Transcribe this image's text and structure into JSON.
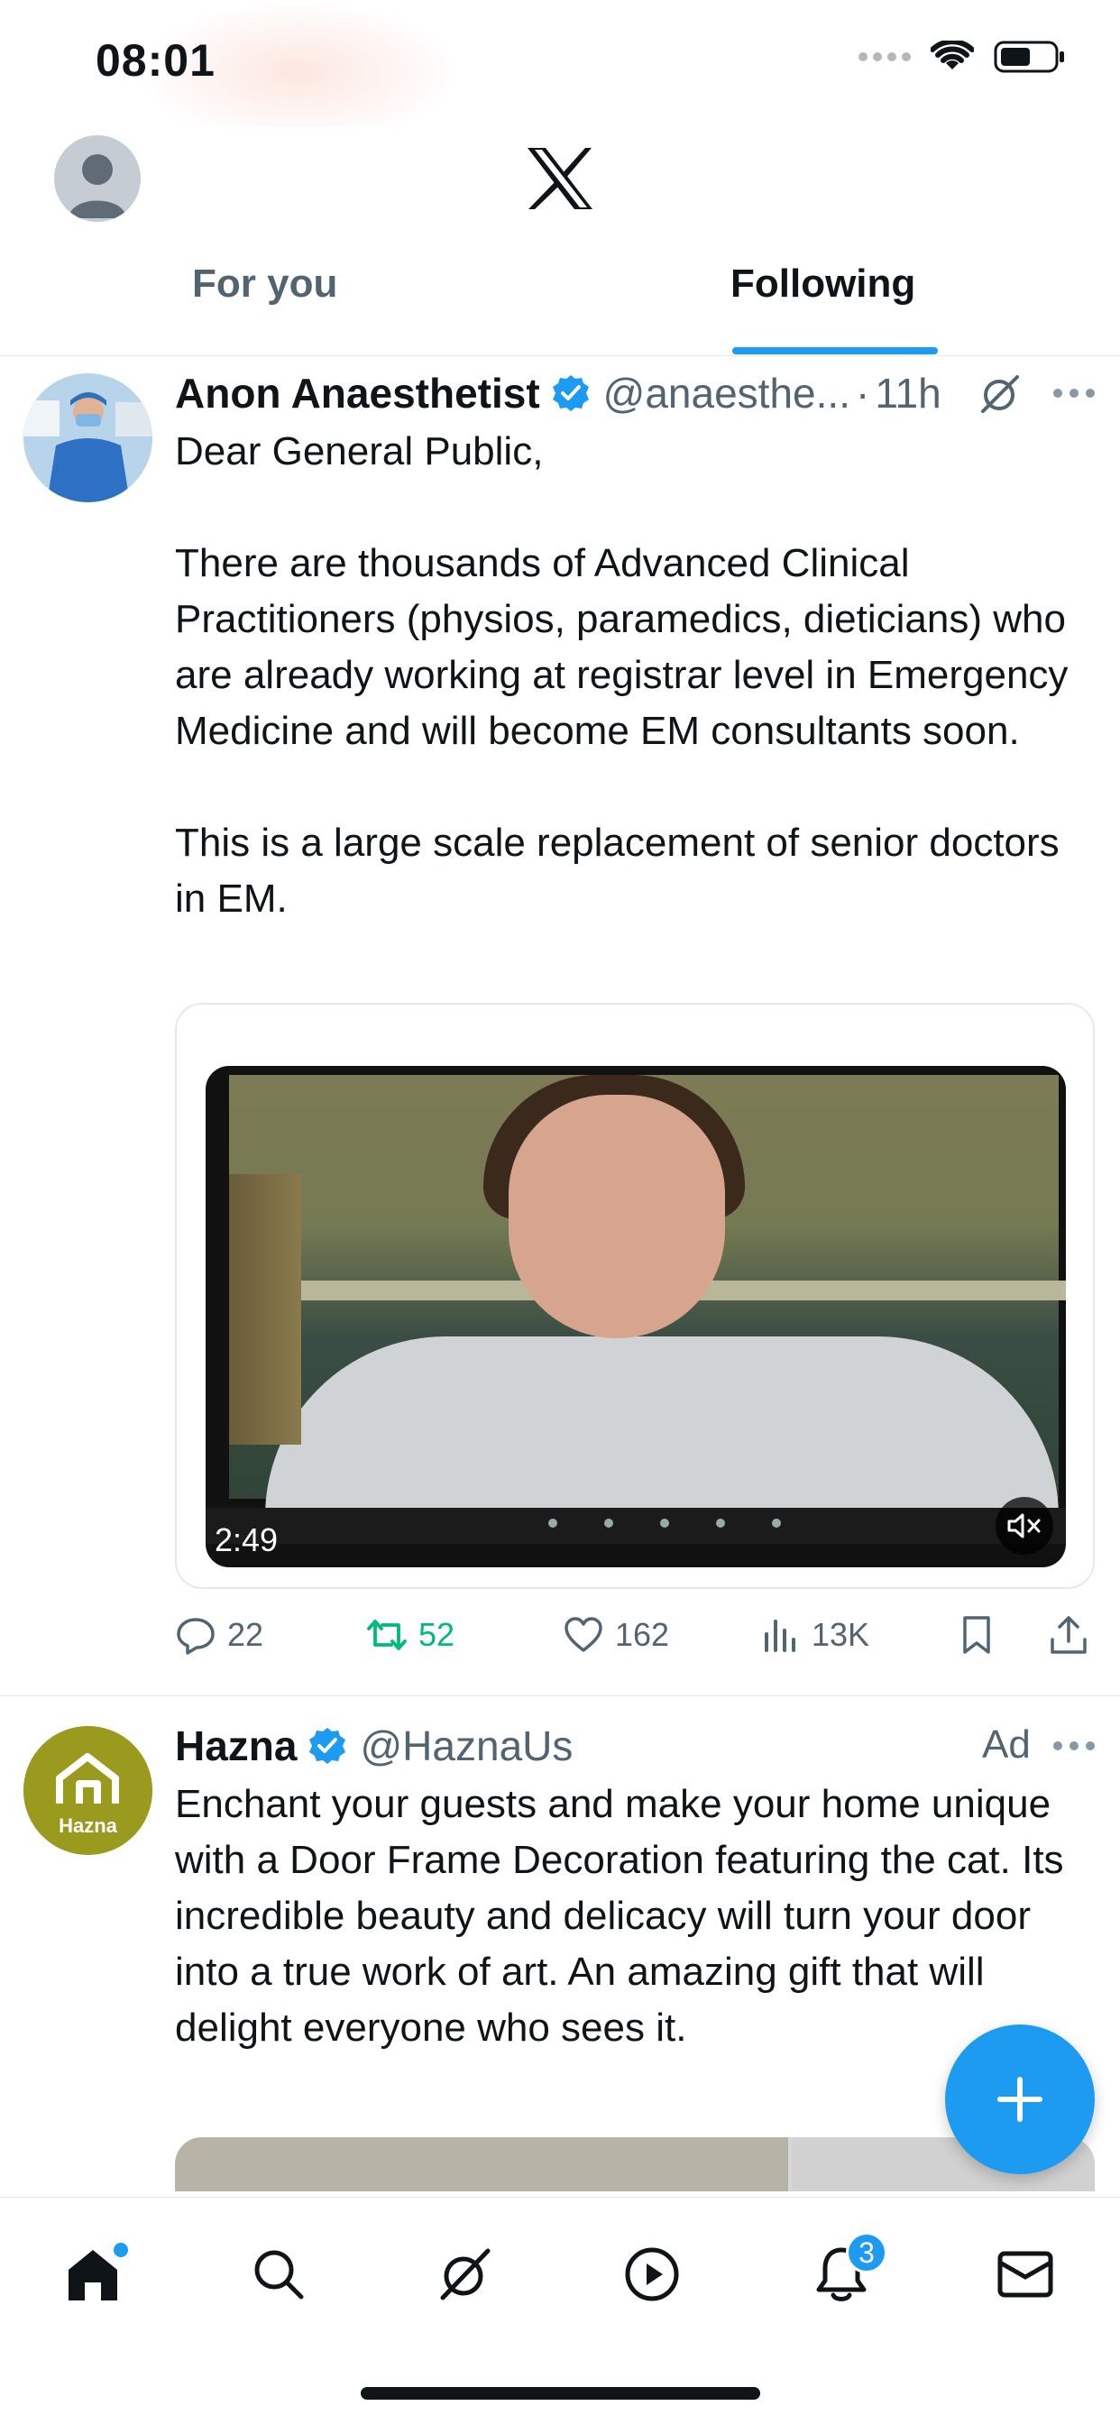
{
  "status_bar": {
    "time": "08:01"
  },
  "header": {
    "tabs": [
      {
        "label": "For you",
        "active": false
      },
      {
        "label": "Following",
        "active": true
      }
    ],
    "accent_color": "#1d9bf0"
  },
  "tweets": [
    {
      "name": "Anon Anaesthetist",
      "handle": "@anaesthe...",
      "separator": "·",
      "time": "11h",
      "verified": true,
      "body": {
        "p1": "Dear General Public,",
        "p2": "There are thousands of Advanced Clinical Practitioners (physios, paramedics, dieticians) who are already working at registrar level in Emergency Medicine and will become EM consultants soon.",
        "p3": "This is a large scale replacement of senior doctors in EM."
      },
      "video": {
        "duration": "2:49",
        "muted": true
      },
      "stats": {
        "replies": "22",
        "retweets": "52",
        "likes": "162",
        "views": "13K"
      }
    },
    {
      "name": "Hazna",
      "handle": "@HaznaUs",
      "ad_label": "Ad",
      "verified": true,
      "avatar_text": "Hazna",
      "body": "Enchant your guests and make your home unique with a Door Frame Decoration featuring the cat. Its incredible beauty and delicacy will turn your door into a true work of art. An amazing gift that will delight everyone who sees it."
    }
  ],
  "nav": {
    "items": [
      "home",
      "search",
      "grok",
      "video",
      "notifications",
      "messages"
    ],
    "notification_count": "3"
  },
  "colors": {
    "retweet_active": "#00ba7c",
    "text_secondary": "#536471"
  }
}
